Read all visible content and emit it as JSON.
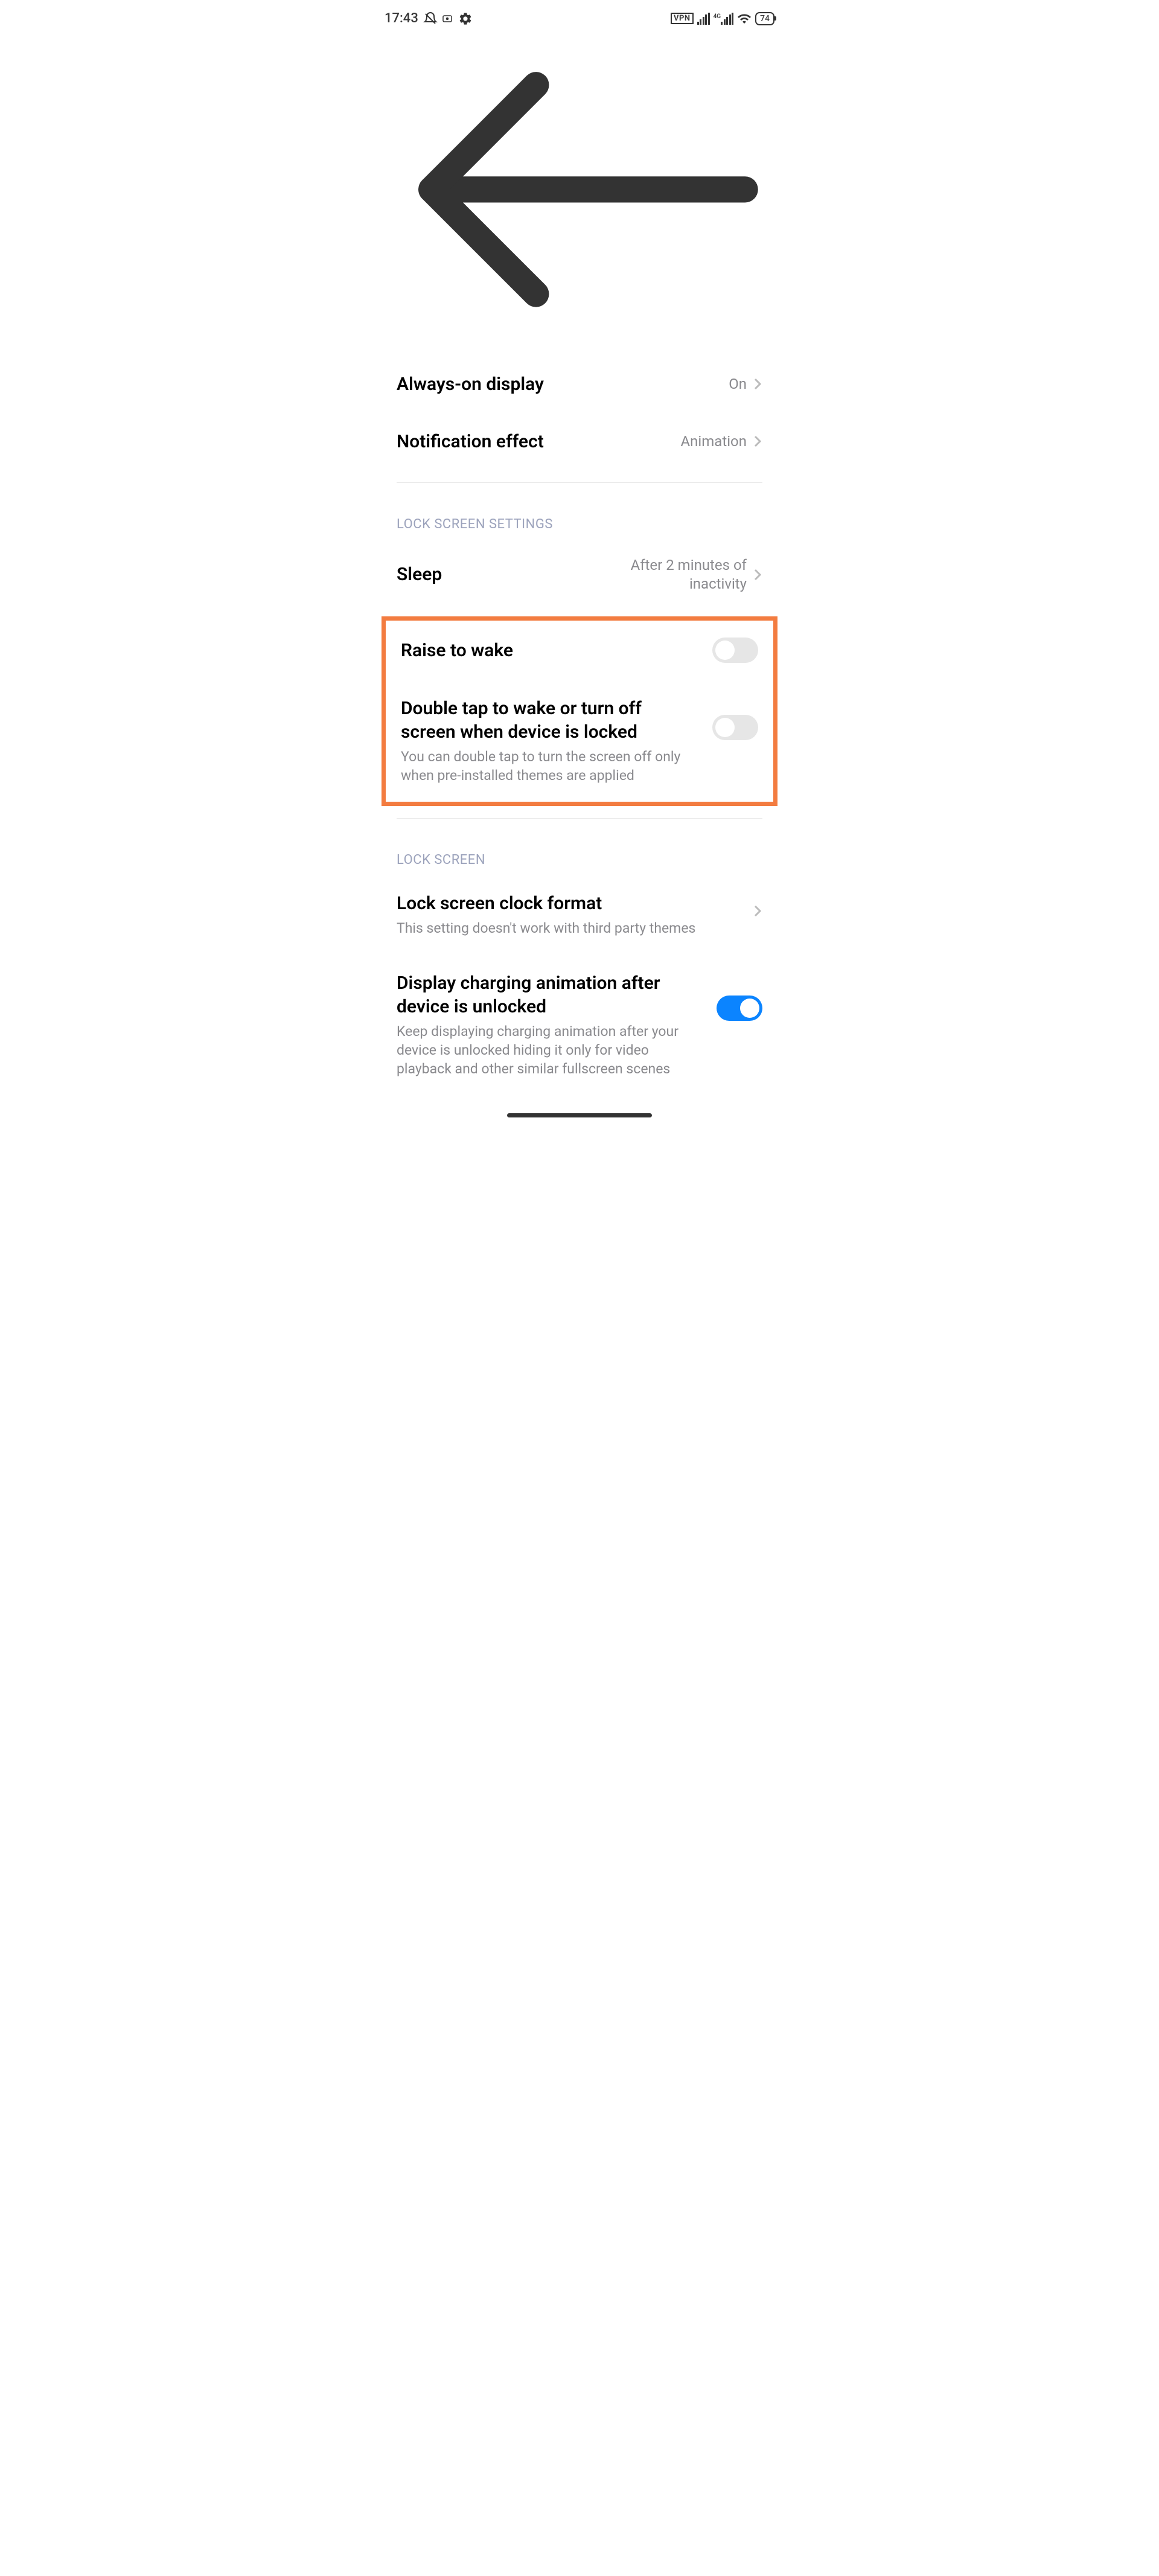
{
  "status": {
    "time": "17:43",
    "vpn": "VPN",
    "network": "4G",
    "battery": "74"
  },
  "rows": {
    "aod": {
      "title": "Always-on display",
      "value": "On"
    },
    "notif_effect": {
      "title": "Notification effect",
      "value": "Animation"
    },
    "sleep": {
      "title": "Sleep",
      "value": "After 2 minutes of inactivity"
    },
    "raise": {
      "title": "Raise to wake"
    },
    "doubletap": {
      "title": "Double tap to wake or turn off screen when device is locked",
      "sub": "You can double tap to turn the screen off only when pre-installed themes are applied"
    },
    "clock_format": {
      "title": "Lock screen clock format",
      "sub": "This setting doesn't work with third party themes"
    },
    "charging_anim": {
      "title": "Display charging animation after device is unlocked",
      "sub": "Keep displaying charging animation after your device is unlocked hiding it only for video playback and other similar fullscreen scenes"
    }
  },
  "sections": {
    "lock_settings": "LOCK SCREEN SETTINGS",
    "lock_screen": "LOCK SCREEN"
  }
}
